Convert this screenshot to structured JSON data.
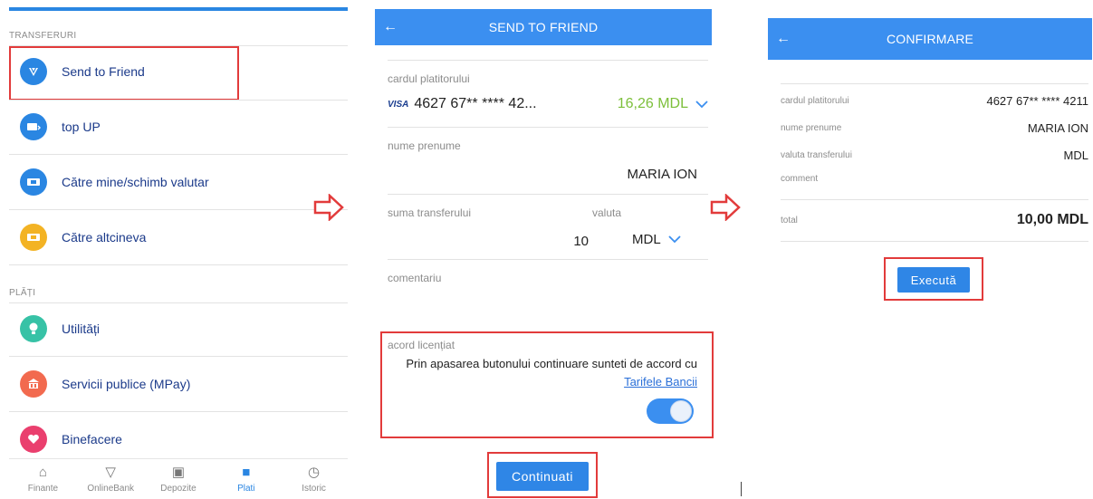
{
  "panel1": {
    "section_transfers": "TRANSFERURI",
    "transfer_items": [
      {
        "label": "Send to Friend",
        "icon": "send-icon",
        "color": "#2a86e2"
      },
      {
        "label": "top UP",
        "icon": "topup-icon",
        "color": "#2a86e2"
      },
      {
        "label": "Către mine/schimb valutar",
        "icon": "card-exchange-icon",
        "color": "#2a86e2"
      },
      {
        "label": "Către altcineva",
        "icon": "card-icon",
        "color": "#f3b324"
      }
    ],
    "section_payments": "PLĂȚI",
    "payment_items": [
      {
        "label": "Utilități",
        "icon": "bulb-icon",
        "color": "#37c2a6"
      },
      {
        "label": "Servicii publice (MPay)",
        "icon": "building-icon",
        "color": "#f26a4f"
      },
      {
        "label": "Binefacere",
        "icon": "heart-icon",
        "color": "#ea3f6e"
      }
    ],
    "tabs": [
      {
        "label": "Finante",
        "icon": "home-icon"
      },
      {
        "label": "OnlineBank",
        "icon": "onlinebank-icon"
      },
      {
        "label": "Depozite",
        "icon": "deposit-icon"
      },
      {
        "label": "Plati",
        "icon": "wallet-icon",
        "active": true
      },
      {
        "label": "Istoric",
        "icon": "history-icon"
      }
    ]
  },
  "panel2": {
    "title": "SEND TO FRIEND",
    "payer_card_label": "cardul platitorului",
    "card_brand": "VISA",
    "card_number": "4627 67** **** 42...",
    "card_balance": "16,26 MDL",
    "name_label": "nume prenume",
    "name_value": "MARIA ION",
    "amount_label": "suma transferului",
    "currency_label": "valuta",
    "amount_value": "10",
    "currency_value": "MDL",
    "comment_label": "comentariu",
    "license_label": "acord licențiat",
    "license_text": "Prin apasarea butonului continuare sunteti de accord cu",
    "license_link": "Tarifele Bancii",
    "toggle_on": true,
    "continue_label": "Continuati"
  },
  "panel3": {
    "title": "CONFIRMARE",
    "payer_card_label": "cardul platitorului",
    "payer_card_value": "4627 67** **** 4211",
    "name_label": "nume prenume",
    "name_value": "MARIA ION",
    "currency_label": "valuta transferului",
    "currency_value": "MDL",
    "comment_label": "comment",
    "total_label": "total",
    "total_value": "10,00 MDL",
    "execute_label": "Execută"
  },
  "colors": {
    "accent": "#3b8ff0",
    "highlight": "#e23b3b",
    "balance": "#7cbf3a"
  }
}
